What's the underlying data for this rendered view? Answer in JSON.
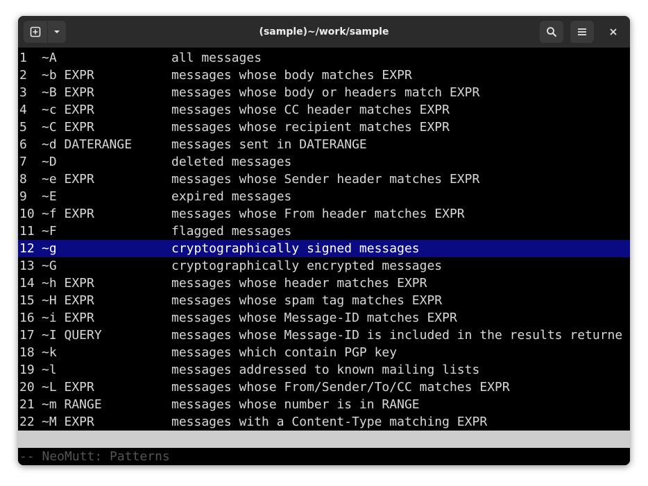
{
  "window": {
    "title": "(sample)~/work/sample"
  },
  "toolbar": {
    "new_tab_icon": "new-tab-icon",
    "dropdown_icon": "chevron-down-icon",
    "search_icon": "search-icon",
    "menu_icon": "hamburger-menu-icon",
    "close_icon": "close-icon"
  },
  "colors": {
    "selection_bg": "#0a0a82",
    "status_bg": "#cdcdcd",
    "terminal_bg": "#000000"
  },
  "patterns": [
    {
      "num": "1",
      "pattern": "~A",
      "desc": "all messages"
    },
    {
      "num": "2",
      "pattern": "~b EXPR",
      "desc": "messages whose body matches EXPR"
    },
    {
      "num": "3",
      "pattern": "~B EXPR",
      "desc": "messages whose body or headers match EXPR"
    },
    {
      "num": "4",
      "pattern": "~c EXPR",
      "desc": "messages whose CC header matches EXPR"
    },
    {
      "num": "5",
      "pattern": "~C EXPR",
      "desc": "messages whose recipient matches EXPR"
    },
    {
      "num": "6",
      "pattern": "~d DATERANGE",
      "desc": "messages sent in DATERANGE"
    },
    {
      "num": "7",
      "pattern": "~D",
      "desc": "deleted messages"
    },
    {
      "num": "8",
      "pattern": "~e EXPR",
      "desc": "messages whose Sender header matches EXPR"
    },
    {
      "num": "9",
      "pattern": "~E",
      "desc": "expired messages"
    },
    {
      "num": "10",
      "pattern": "~f EXPR",
      "desc": "messages whose From header matches EXPR"
    },
    {
      "num": "11",
      "pattern": "~F",
      "desc": "flagged messages"
    },
    {
      "num": "12",
      "pattern": "~g",
      "desc": "cryptographically signed messages"
    },
    {
      "num": "13",
      "pattern": "~G",
      "desc": "cryptographically encrypted messages"
    },
    {
      "num": "14",
      "pattern": "~h EXPR",
      "desc": "messages whose header matches EXPR"
    },
    {
      "num": "15",
      "pattern": "~H EXPR",
      "desc": "messages whose spam tag matches EXPR"
    },
    {
      "num": "16",
      "pattern": "~i EXPR",
      "desc": "messages whose Message-ID matches EXPR"
    },
    {
      "num": "17",
      "pattern": "~I QUERY",
      "desc": "messages whose Message-ID is included in the results returne"
    },
    {
      "num": "18",
      "pattern": "~k",
      "desc": "messages which contain PGP key"
    },
    {
      "num": "19",
      "pattern": "~l",
      "desc": "messages addressed to known mailing lists"
    },
    {
      "num": "20",
      "pattern": "~L EXPR",
      "desc": "messages whose From/Sender/To/CC matches EXPR"
    },
    {
      "num": "21",
      "pattern": "~m RANGE",
      "desc": "messages whose number is in RANGE"
    },
    {
      "num": "22",
      "pattern": "~M EXPR",
      "desc": "messages with a Content-Type matching EXPR"
    }
  ],
  "selected_index": 11,
  "status": {
    "text": "-- NeoMutt: Patterns"
  }
}
